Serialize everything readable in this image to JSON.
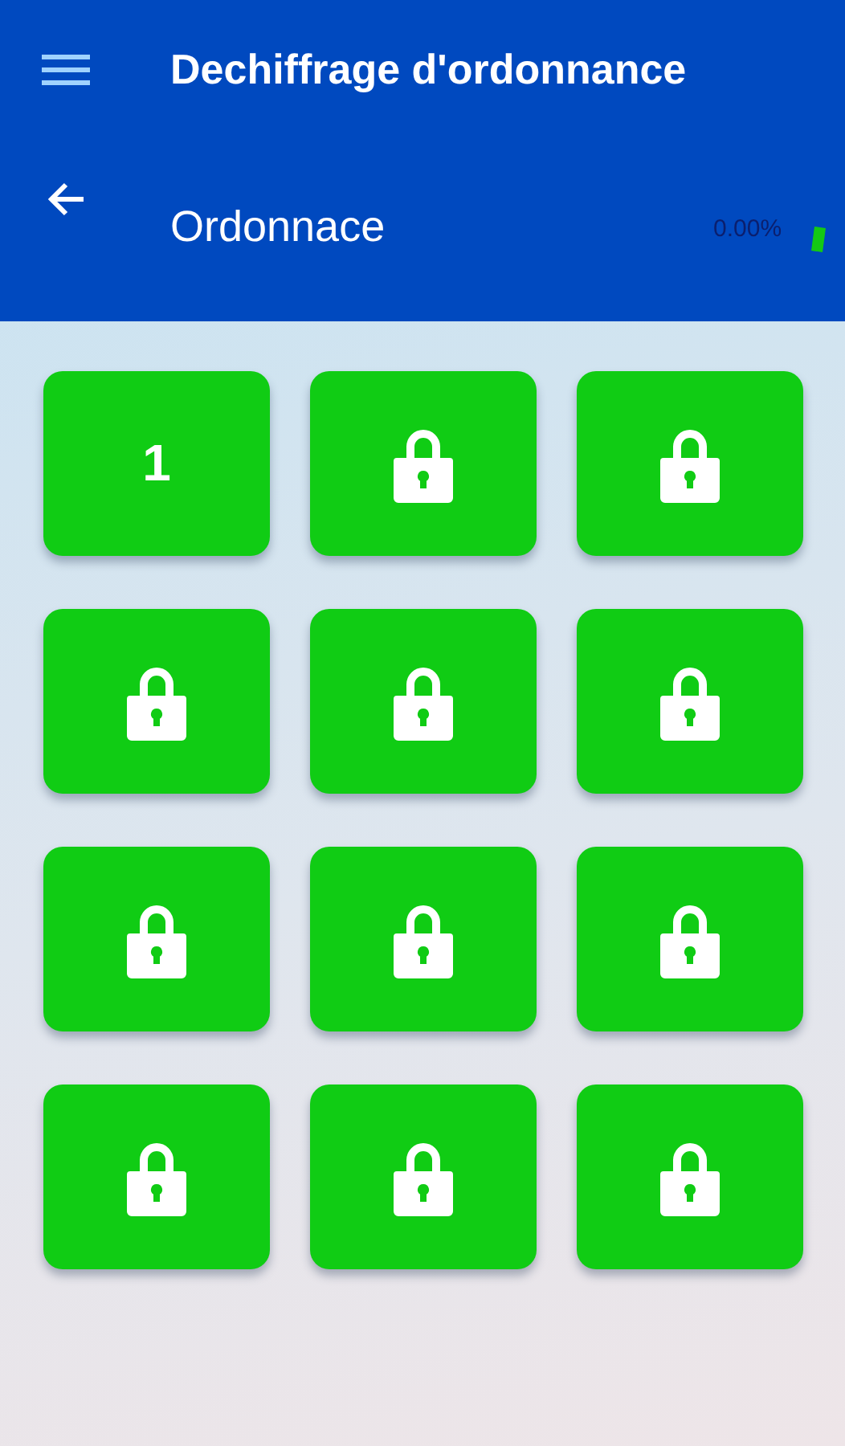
{
  "app_bar": {
    "title": "Dechiffrage d'ordonnance"
  },
  "sub_header": {
    "title": "Ordonnace",
    "progress_text": "0.00%"
  },
  "levels": [
    {
      "kind": "unlocked",
      "label": "1"
    },
    {
      "kind": "locked"
    },
    {
      "kind": "locked"
    },
    {
      "kind": "locked"
    },
    {
      "kind": "locked"
    },
    {
      "kind": "locked"
    },
    {
      "kind": "locked"
    },
    {
      "kind": "locked"
    },
    {
      "kind": "locked"
    },
    {
      "kind": "locked"
    },
    {
      "kind": "locked"
    },
    {
      "kind": "locked"
    }
  ]
}
